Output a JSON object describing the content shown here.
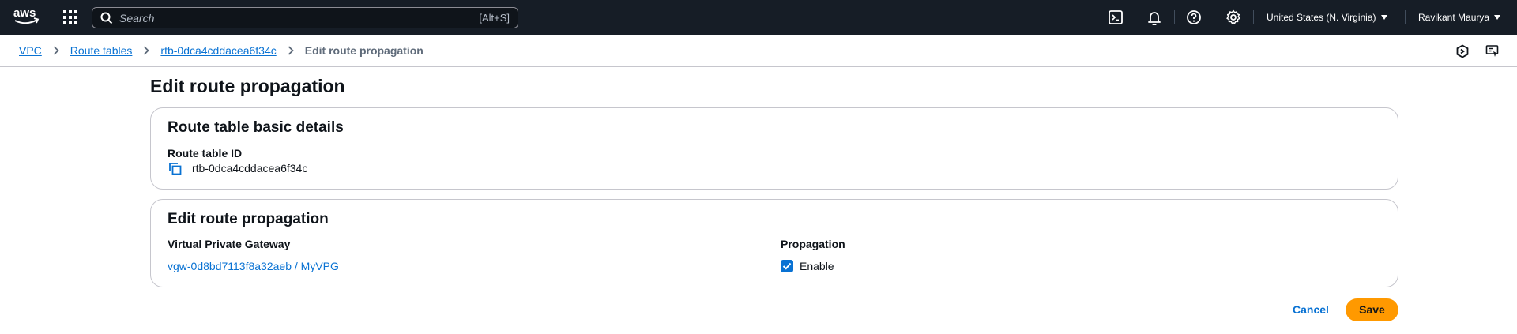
{
  "topnav": {
    "search_placeholder": "Search",
    "search_shortcut": "[Alt+S]",
    "region": "United States (N. Virginia)",
    "user": "Ravikant Maurya",
    "icons": [
      "aws-logo",
      "apps-grid-icon",
      "search-icon",
      "cloudshell-icon",
      "bell-icon",
      "help-icon",
      "settings-icon"
    ]
  },
  "breadcrumb": {
    "items": [
      "VPC",
      "Route tables",
      "rtb-0dca4cddacea6f34c"
    ],
    "current": "Edit route propagation"
  },
  "page": {
    "title": "Edit route propagation"
  },
  "basic_details": {
    "title": "Route table basic details",
    "route_table_id_label": "Route table ID",
    "route_table_id": "rtb-0dca4cddacea6f34c"
  },
  "propagation": {
    "title": "Edit route propagation",
    "vgw_header": "Virtual Private Gateway",
    "propagation_header": "Propagation",
    "rows": [
      {
        "gateway": "vgw-0d8bd7113f8a32aeb / MyVPG",
        "enable_label": "Enable",
        "enabled": true
      }
    ]
  },
  "actions": {
    "cancel": "Cancel",
    "save": "Save"
  },
  "colors": {
    "nav_bg": "#161d26",
    "link": "#0972d3",
    "primary": "#ff9900",
    "border": "#c6c6cd"
  }
}
